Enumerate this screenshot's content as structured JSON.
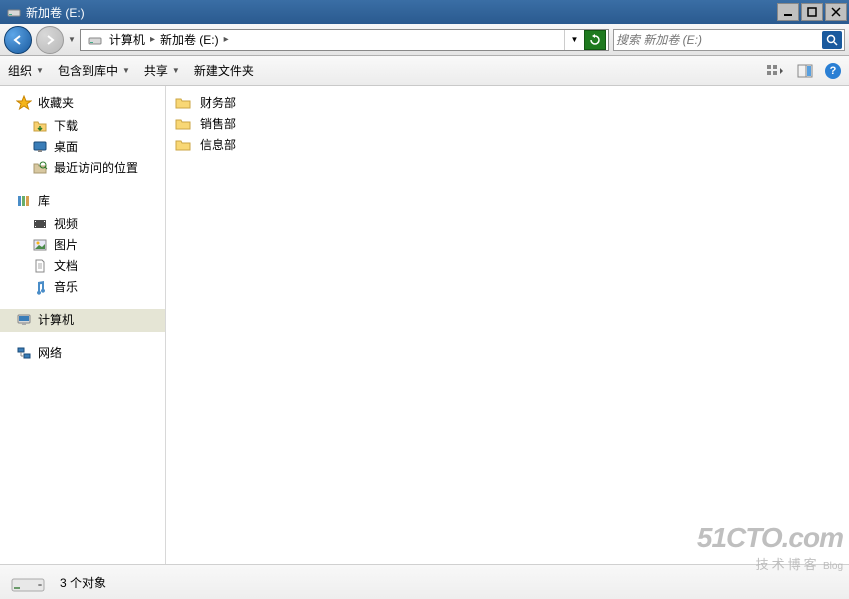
{
  "window": {
    "title": "新加卷 (E:)"
  },
  "breadcrumb": {
    "root": "计算机",
    "current": "新加卷 (E:)"
  },
  "search": {
    "placeholder": "搜索 新加卷 (E:)"
  },
  "toolbar": {
    "organize": "组织",
    "include": "包含到库中",
    "share": "共享",
    "newfolder": "新建文件夹"
  },
  "sidebar": {
    "favorites": {
      "label": "收藏夹",
      "items": [
        "下载",
        "桌面",
        "最近访问的位置"
      ]
    },
    "libraries": {
      "label": "库",
      "items": [
        "视频",
        "图片",
        "文档",
        "音乐"
      ]
    },
    "computer": {
      "label": "计算机"
    },
    "network": {
      "label": "网络"
    }
  },
  "files": [
    "财务部",
    "销售部",
    "信息部"
  ],
  "status": {
    "count": "3 个对象"
  },
  "watermark": {
    "big": "51CTO.com",
    "small": "技术博客",
    "blog": "Blog"
  }
}
